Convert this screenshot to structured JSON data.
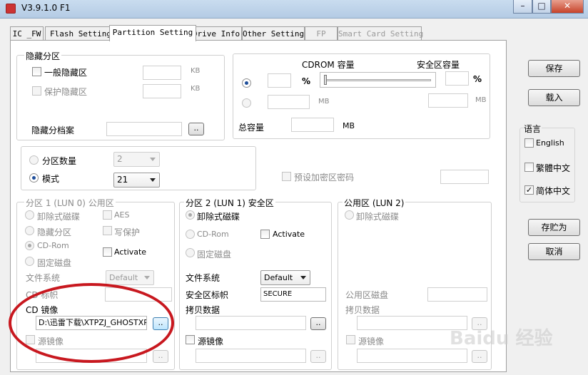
{
  "window": {
    "title": "V3.9.1.0 F1"
  },
  "tabs": [
    {
      "label": "IC _FW",
      "state": "normal"
    },
    {
      "label": "Flash Setting",
      "state": "normal"
    },
    {
      "label": "Partition Setting",
      "state": "active"
    },
    {
      "label": "Drive Info",
      "state": "normal"
    },
    {
      "label": "Other Setting",
      "state": "normal"
    },
    {
      "label": "FP",
      "state": "disabled"
    },
    {
      "label": "Smart Card Setting",
      "state": "disabled"
    }
  ],
  "hidden": {
    "title": "隐藏分区",
    "general_label": "一般隐藏区",
    "protect_label": "保护隐藏区",
    "unit_kb": "KB",
    "archive_label": "隐藏分档案",
    "browse": ".."
  },
  "cdrom": {
    "cap_label": "CDROM 容量",
    "secure_label": "安全区容量",
    "percent": "%",
    "mb": "MB",
    "total_label": "总容量",
    "total_unit": "MB"
  },
  "mode": {
    "count_label": "分区数量",
    "count_value": "2",
    "mode_label": "模式",
    "mode_value": "21",
    "preset_pwd_label": "预设加密区密码"
  },
  "p1": {
    "title": "分区 1 (LUN 0) 公用区",
    "removable": "卸除式磁碟",
    "hidden": "隐藏分区",
    "cdrom": "CD-Rom",
    "fixed": "固定磁盘",
    "aes": "AES",
    "write_protect": "写保护",
    "activate": "Activate",
    "fs_label": "文件系统",
    "fs_value": "Default",
    "cd_label_text": "CD 标帜",
    "cd_image_label": "CD 镜像",
    "cd_image_path": "D:\\迅雷下载\\XTPZJ_GHOSTXP",
    "source_image": "源镜像",
    "browse": ".."
  },
  "p2": {
    "title": "分区 2 (LUN 1) 安全区",
    "removable": "卸除式磁碟",
    "cdrom": "CD-Rom",
    "fixed": "固定磁盘",
    "activate": "Activate",
    "fs_label": "文件系统",
    "fs_value": "Default",
    "secure_label": "安全区标帜",
    "secure_value": "SECURE",
    "copy_label": "拷贝数据",
    "source_image": "源镜像",
    "browse": ".."
  },
  "p3": {
    "title": "公用区 (LUN 2)",
    "removable": "卸除式磁碟",
    "disk_label": "公用区磁盘",
    "copy_label": "拷贝数据",
    "source_image": "源镜像",
    "browse": ".."
  },
  "side": {
    "save": "保存",
    "load": "载入",
    "lang_title": "语言",
    "english": "English",
    "trad": "繁體中文",
    "simp": "简体中文",
    "save_as": "存贮为",
    "cancel": "取消"
  },
  "watermark": "Baidu 经验"
}
